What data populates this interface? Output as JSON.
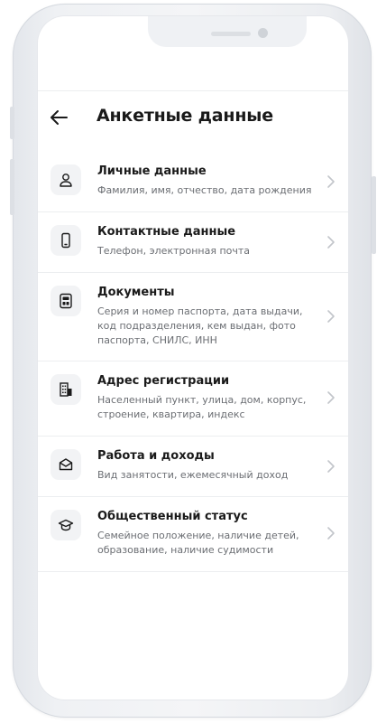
{
  "header": {
    "title": "Анкетные данные",
    "back_icon": "arrow-left-icon"
  },
  "colors": {
    "text_primary": "#1a1a1a",
    "text_secondary": "#6b6e73",
    "icon_bg": "#f2f3f5",
    "divider": "#eceef0",
    "chevron": "#c2c5ca"
  },
  "sections": [
    {
      "icon": "person-icon",
      "title": "Личные данные",
      "subtitle": "Фамилия, имя, отчество, дата рождения"
    },
    {
      "icon": "phone-icon",
      "title": "Контактные данные",
      "subtitle": "Телефон, электронная почта"
    },
    {
      "icon": "id-card-icon",
      "title": "Документы",
      "subtitle": "Серия и номер паспорта, дата выдачи, код подразделения, кем выдан, фото паспорта, СНИЛС, ИНН"
    },
    {
      "icon": "building-icon",
      "title": "Адрес регистрации",
      "subtitle": "Населенный пункт, улица, дом, корпус, строение, квартира, индекс"
    },
    {
      "icon": "briefcase-icon",
      "title": "Работа и доходы",
      "subtitle": "Вид занятости, ежемесячный доход"
    },
    {
      "icon": "graduation-cap-icon",
      "title": "Общественный статус",
      "subtitle": "Семейное положение, наличие детей, образование, наличие судимости"
    }
  ]
}
